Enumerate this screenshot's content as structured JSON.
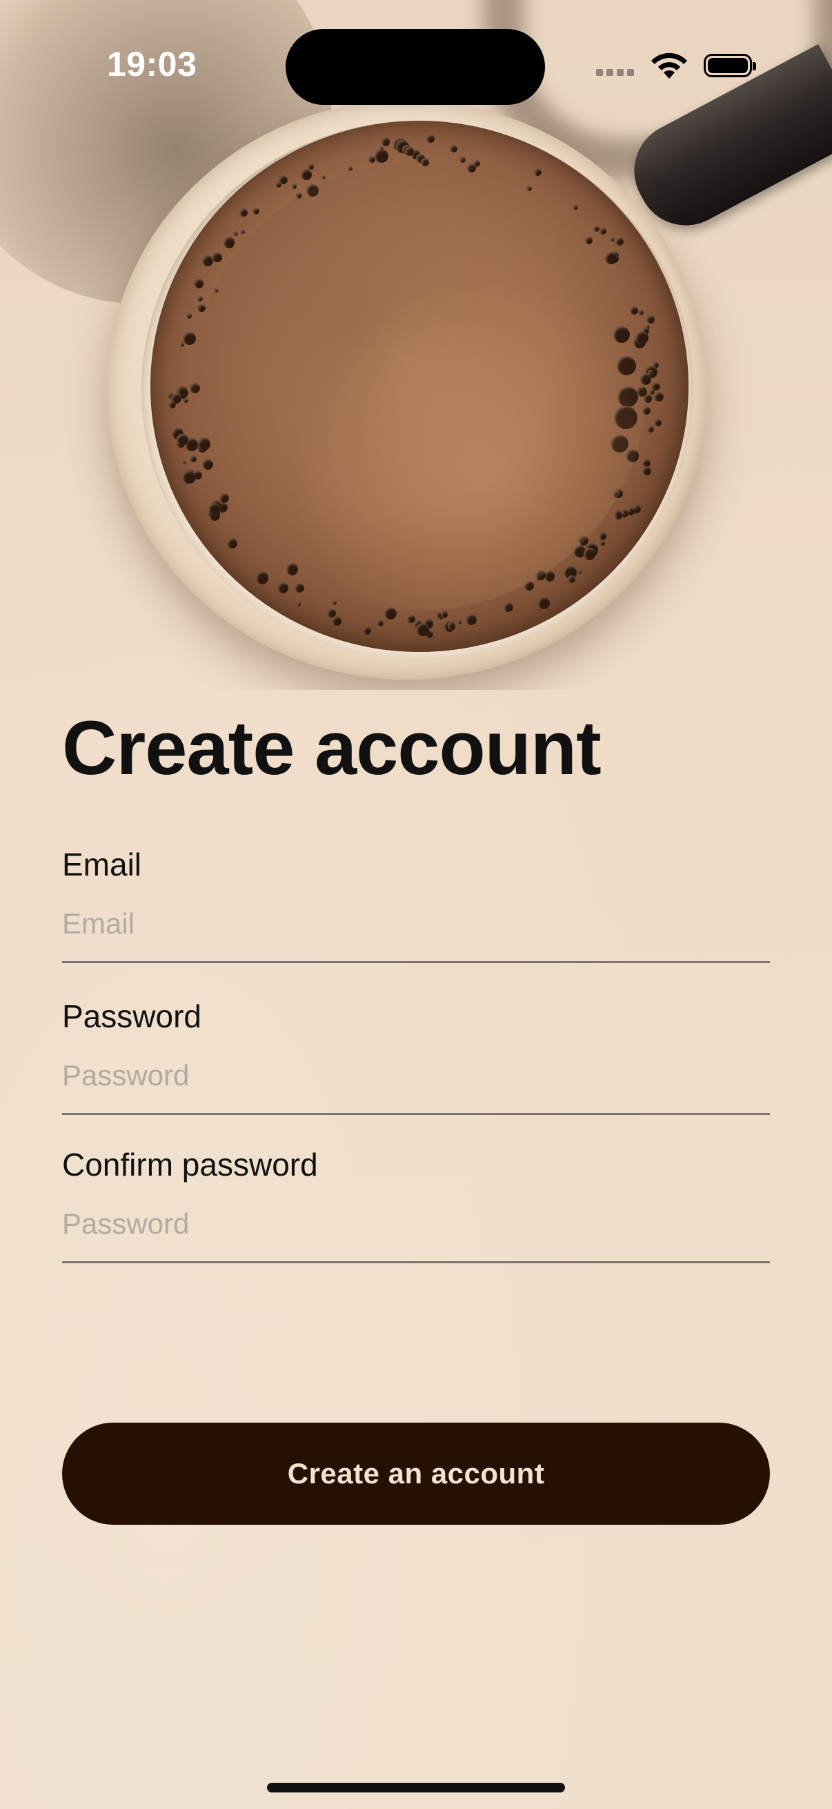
{
  "status_bar": {
    "time": "19:03"
  },
  "screen": {
    "title": "Create account"
  },
  "form": {
    "fields": [
      {
        "label": "Email",
        "placeholder": "Email",
        "value": ""
      },
      {
        "label": "Password",
        "placeholder": "Password",
        "value": ""
      },
      {
        "label": "Confirm password",
        "placeholder": "Password",
        "value": ""
      }
    ],
    "submit_label": "Create an account"
  },
  "colors": {
    "background": "#efdfcc",
    "button": "#261005",
    "button_text": "#f3e3cf",
    "title_text": "#111111",
    "placeholder": "#b3aaa1",
    "underline": "#7c7571"
  },
  "icons": [
    "cellular-signal-icon",
    "wifi-icon",
    "battery-icon"
  ]
}
